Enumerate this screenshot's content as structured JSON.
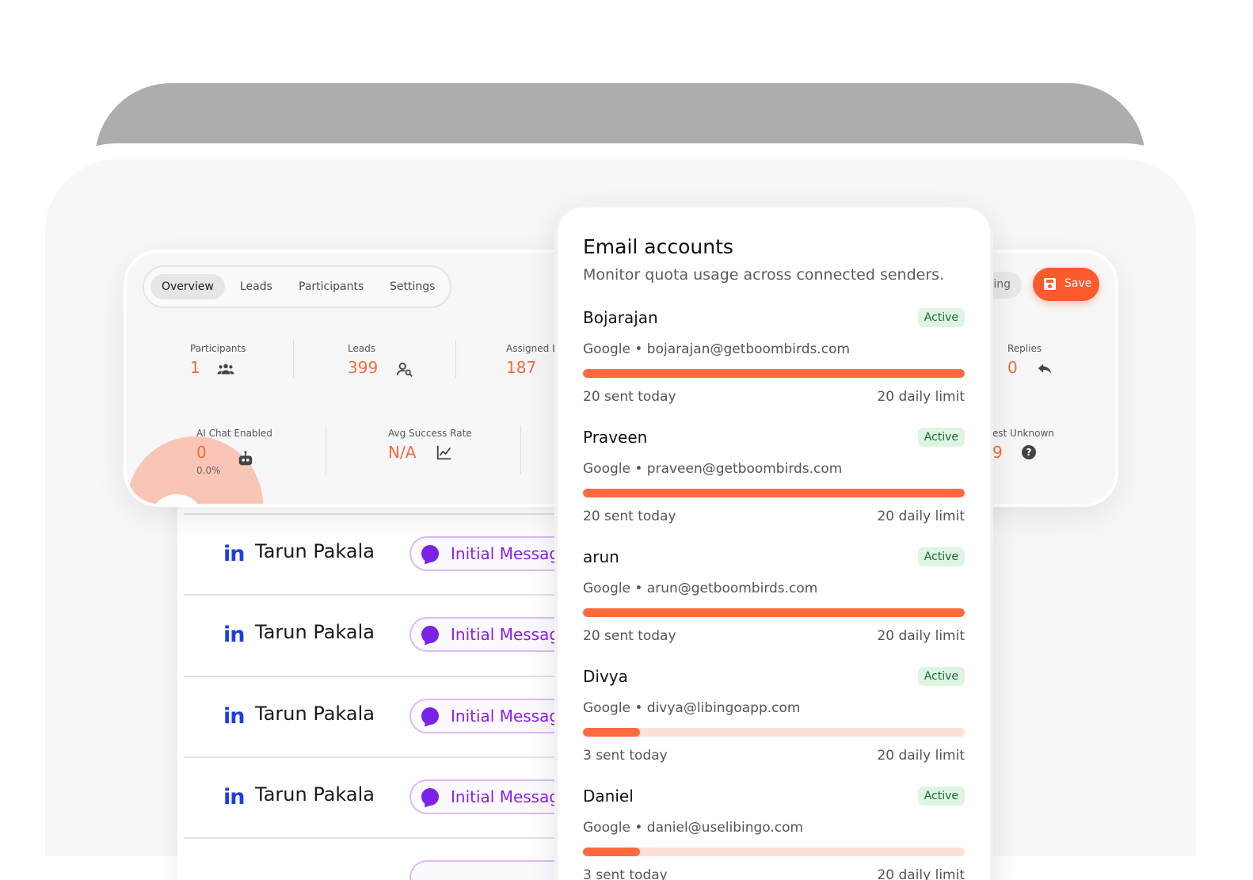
{
  "colors": {
    "accent": "#fc6a3e",
    "save_button": "#fb5b2c",
    "badge_bg": "#ddf5e2",
    "badge_text": "#1a6a33",
    "linkedin": "#1d3fe0",
    "message_purple": "#8a1fe8"
  },
  "tabs": [
    "Overview",
    "Leads",
    "Participants",
    "Settings"
  ],
  "active_tab": "Overview",
  "toolbar": {
    "partial_pill_label": "ing",
    "save_label": "Save"
  },
  "stats": {
    "participants": {
      "label": "Participants",
      "value": "1",
      "icon": "group-icon"
    },
    "leads": {
      "label": "Leads",
      "value": "399",
      "icon": "person-search-icon"
    },
    "assigned": {
      "label": "Assigned L",
      "value": "187"
    },
    "replies": {
      "label": "Replies",
      "value": "0",
      "icon": "reply-icon"
    },
    "ai_chat": {
      "label": "AI Chat Enabled",
      "value": "0",
      "sub": "0.0%",
      "icon": "robot-icon"
    },
    "avg_success": {
      "label": "Avg Success Rate",
      "value": "N/A",
      "icon": "trend-chart-icon"
    },
    "interest_unknown": {
      "label": "est Unknown",
      "value": "9",
      "icon": "help-circle-icon"
    }
  },
  "list_rows": [
    {
      "icon": "in",
      "name": "Tarun Pakala",
      "status": "Initial Messag"
    },
    {
      "icon": "in",
      "name": "Tarun Pakala",
      "status": "Initial Messag"
    },
    {
      "icon": "in",
      "name": "Tarun Pakala",
      "status": "Initial Messag"
    },
    {
      "icon": "in",
      "name": "Tarun Pakala",
      "status": "Initial Messag"
    }
  ],
  "email_panel": {
    "title": "Email accounts",
    "subtitle": "Monitor quota usage across connected senders.",
    "accounts": [
      {
        "name": "Bojarajan",
        "status": "Active",
        "provider_email": "Google • bojarajan@getboombirds.com",
        "sent": 20,
        "limit": 20,
        "sent_label": "20 sent today",
        "limit_label": "20 daily limit"
      },
      {
        "name": "Praveen",
        "status": "Active",
        "provider_email": "Google • praveen@getboombirds.com",
        "sent": 20,
        "limit": 20,
        "sent_label": "20 sent today",
        "limit_label": "20 daily limit"
      },
      {
        "name": "arun",
        "status": "Active",
        "provider_email": "Google • arun@getboombirds.com",
        "sent": 20,
        "limit": 20,
        "sent_label": "20 sent today",
        "limit_label": "20 daily limit"
      },
      {
        "name": "Divya",
        "status": "Active",
        "provider_email": "Google • divya@libingoapp.com",
        "sent": 3,
        "limit": 20,
        "sent_label": "3 sent today",
        "limit_label": "20 daily limit"
      },
      {
        "name": "Daniel",
        "status": "Active",
        "provider_email": "Google • daniel@uselibingo.com",
        "sent": 3,
        "limit": 20,
        "sent_label": "3 sent today",
        "limit_label": "20 daily limit"
      }
    ]
  }
}
